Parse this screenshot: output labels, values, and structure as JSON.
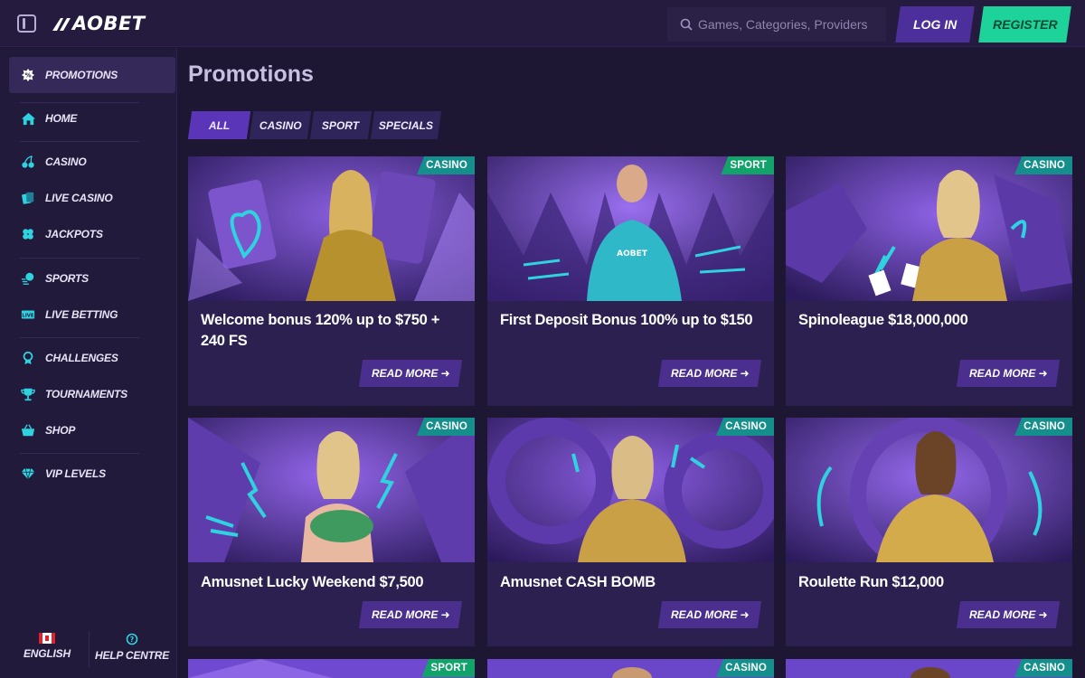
{
  "header": {
    "logo_text": "AOBET",
    "search_placeholder": "Games, Categories, Providers",
    "login_label": "LOG IN",
    "register_label": "REGISTER"
  },
  "sidebar": {
    "items": [
      {
        "label": "PROMOTIONS",
        "icon": "promotions-icon"
      },
      {
        "label": "HOME",
        "icon": "home-icon"
      },
      {
        "label": "CASINO",
        "icon": "cherries-icon"
      },
      {
        "label": "LIVE CASINO",
        "icon": "live-casino-icon"
      },
      {
        "label": "JACKPOTS",
        "icon": "clover-icon"
      },
      {
        "label": "SPORTS",
        "icon": "sports-icon"
      },
      {
        "label": "LIVE BETTING",
        "icon": "live-badge-icon"
      },
      {
        "label": "CHALLENGES",
        "icon": "medal-icon"
      },
      {
        "label": "TOURNAMENTS",
        "icon": "trophy-icon"
      },
      {
        "label": "SHOP",
        "icon": "basket-icon"
      },
      {
        "label": "VIP LEVELS",
        "icon": "diamond-icon"
      }
    ],
    "footer": {
      "language_label": "ENGLISH",
      "help_label": "HELP CENTRE"
    }
  },
  "main": {
    "title": "Promotions",
    "tabs": [
      {
        "label": "ALL",
        "active": true
      },
      {
        "label": "CASINO",
        "active": false
      },
      {
        "label": "SPORT",
        "active": false
      },
      {
        "label": "SPECIALS",
        "active": false
      }
    ],
    "read_more_label": "READ MORE",
    "cards": [
      {
        "badge": "CASINO",
        "title": "Welcome bonus 120% up to $750 + 240 FS"
      },
      {
        "badge": "SPORT",
        "title": "First Deposit Bonus 100% up to $150"
      },
      {
        "badge": "CASINO",
        "title": "Spinoleague $18,000,000"
      },
      {
        "badge": "CASINO",
        "title": "Amusnet Lucky Weekend $7,500"
      },
      {
        "badge": "CASINO",
        "title": "Amusnet CASH BOMB"
      },
      {
        "badge": "CASINO",
        "title": "Roulette Run $12,000"
      },
      {
        "badge": "SPORT",
        "title": ""
      },
      {
        "badge": "CASINO",
        "title": ""
      },
      {
        "badge": "CASINO",
        "title": ""
      }
    ]
  },
  "colors": {
    "accent_purple": "#5a35b8",
    "register_green": "#1ed39a",
    "casino_badge": "#148f8c",
    "sport_badge": "#12a36a",
    "icon_cyan": "#2fd3e0"
  }
}
